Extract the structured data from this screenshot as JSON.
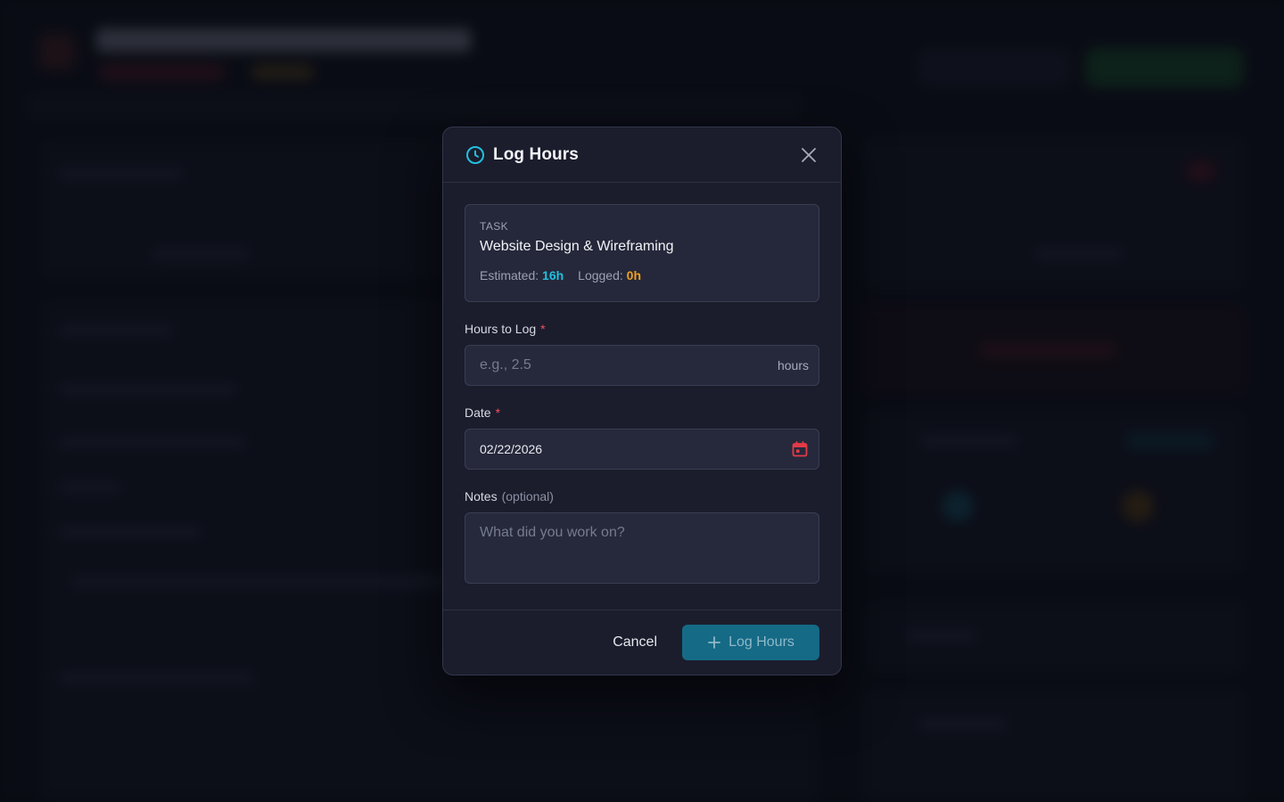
{
  "modal": {
    "title": "Log Hours",
    "close_icon": "close-icon",
    "header_icon": "clock-icon",
    "task": {
      "label": "TASK",
      "name": "Website Design & Wireframing",
      "estimated_label": "Estimated:",
      "estimated_value": "16h",
      "logged_label": "Logged:",
      "logged_value": "0h"
    },
    "hours_field": {
      "label": "Hours to Log",
      "required_mark": "*",
      "placeholder": "e.g., 2.5",
      "suffix": "hours"
    },
    "date_field": {
      "label": "Date",
      "required_mark": "*",
      "value": "02/22/2026",
      "icon": "calendar-icon"
    },
    "notes_field": {
      "label": "Notes",
      "optional": "(optional)",
      "placeholder": "What did you work on?"
    },
    "footer": {
      "cancel_label": "Cancel",
      "submit_label": "Log Hours",
      "submit_icon": "plus-icon"
    }
  },
  "colors": {
    "accent_cyan": "#22c0e0",
    "accent_amber": "#f0a020",
    "required_red": "#f05060",
    "submit_bg": "#156a86"
  }
}
